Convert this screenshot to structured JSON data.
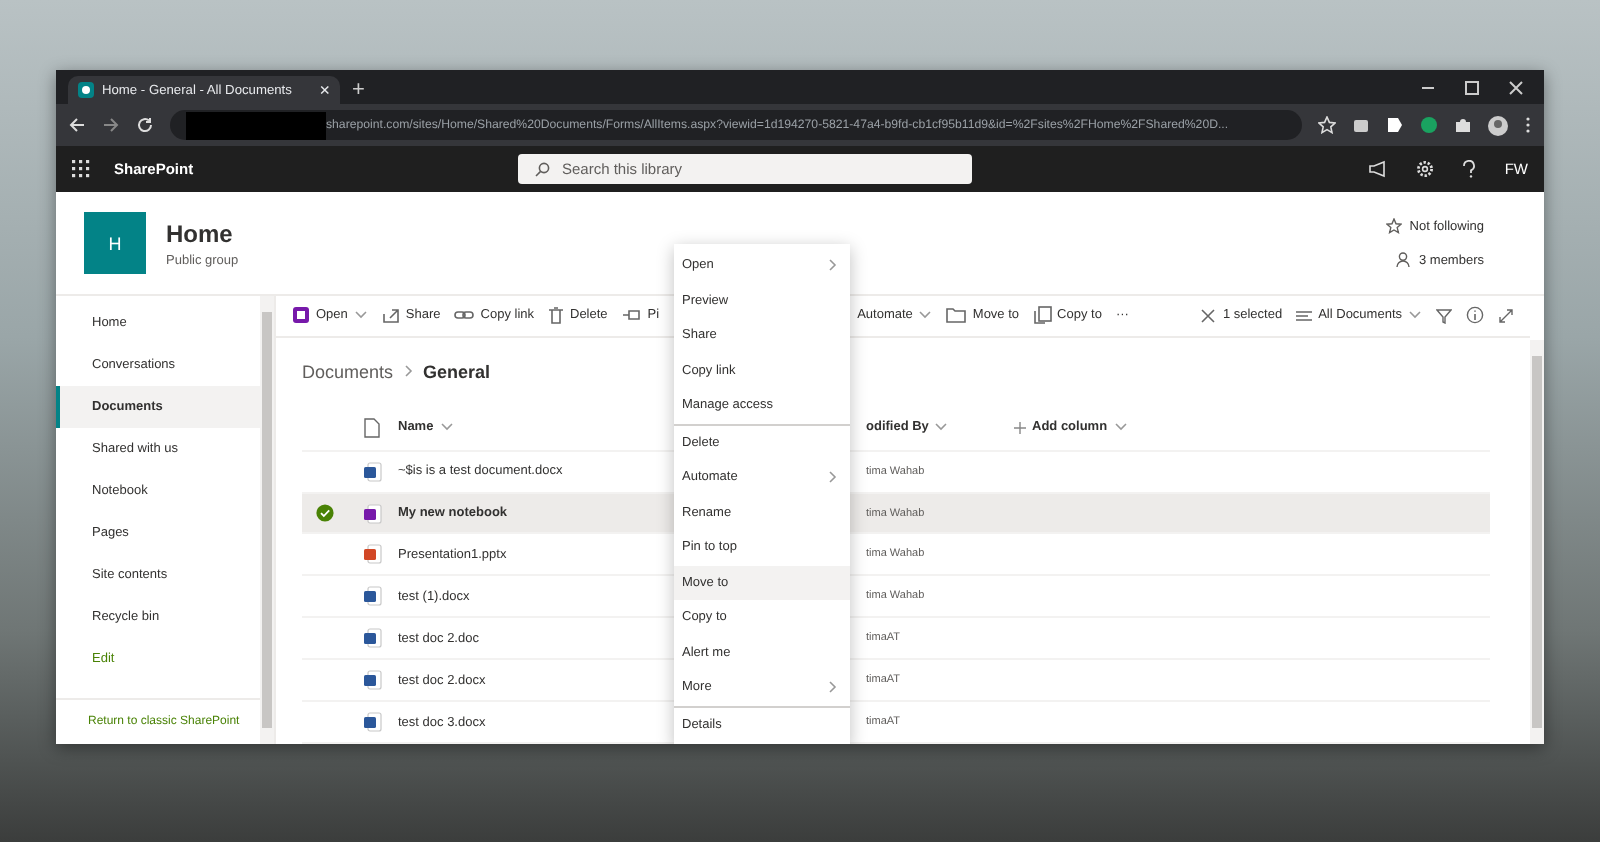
{
  "browser": {
    "tab_title": "Home - General - All Documents",
    "tab_close": "×",
    "new_tab": "+",
    "address": "sharepoint.com/sites/Home/Shared%20Documents/Forms/AllItems.aspx?viewid=1d194270-5821-47a4-b9fd-cb1cf95b11d9&id=%2Fsites%2FHome%2FShared%20D..."
  },
  "suite_bar": {
    "app_name": "SharePoint",
    "search_placeholder": "Search this library",
    "user_initials": "FW"
  },
  "site": {
    "logo_letter": "H",
    "title": "Home",
    "subtitle": "Public group",
    "follow": "Not following",
    "members": "3 members"
  },
  "nav": {
    "items": [
      {
        "label": "Home",
        "selected": false,
        "kind": "page"
      },
      {
        "label": "Conversations",
        "selected": false,
        "kind": "page"
      },
      {
        "label": "Documents",
        "selected": true,
        "kind": "page"
      },
      {
        "label": "Shared with us",
        "selected": false,
        "kind": "page"
      },
      {
        "label": "Notebook",
        "selected": false,
        "kind": "page"
      },
      {
        "label": "Pages",
        "selected": false,
        "kind": "page"
      },
      {
        "label": "Site contents",
        "selected": false,
        "kind": "page"
      },
      {
        "label": "Recycle bin",
        "selected": false,
        "kind": "page"
      },
      {
        "label": "Edit",
        "selected": false,
        "kind": "link"
      }
    ],
    "footer": "Return to classic SharePoint"
  },
  "command_bar": {
    "items": [
      {
        "label": "Open",
        "kind": "notebook",
        "dropdown": true
      },
      {
        "label": "Share",
        "kind": "share",
        "dropdown": false
      },
      {
        "label": "Copy link",
        "kind": "link",
        "dropdown": false
      },
      {
        "label": "Delete",
        "kind": "trash",
        "dropdown": false
      },
      {
        "label": "Pi",
        "kind": "pin",
        "dropdown": false
      },
      {
        "label": "Automate",
        "kind": "plain",
        "dropdown": true
      },
      {
        "label": "Move to",
        "kind": "folder",
        "dropdown": false
      },
      {
        "label": "Copy to",
        "kind": "copy",
        "dropdown": false
      },
      {
        "label": "···",
        "kind": "plain",
        "dropdown": false
      }
    ],
    "selection": "1 selected",
    "view": "All Documents"
  },
  "breadcrumb": [
    "Documents",
    "General"
  ],
  "table": {
    "columns": [
      {
        "label": "Name"
      },
      {
        "label": "odified By"
      },
      {
        "label": "Add column"
      }
    ],
    "rows": [
      {
        "name": "~$is is a test document.docx",
        "kind": "word",
        "modified_by": "tima Wahab",
        "selected": false
      },
      {
        "name": "My new notebook",
        "kind": "onenote",
        "modified_by": "tima Wahab",
        "selected": true
      },
      {
        "name": "Presentation1.pptx",
        "kind": "powerpoint",
        "modified_by": "tima Wahab",
        "selected": false
      },
      {
        "name": "test (1).docx",
        "kind": "word",
        "modified_by": "tima Wahab",
        "selected": false
      },
      {
        "name": "test doc 2.doc",
        "kind": "word",
        "modified_by": "timaAT",
        "selected": false
      },
      {
        "name": "test doc 2.docx",
        "kind": "word",
        "modified_by": "timaAT",
        "selected": false
      },
      {
        "name": "test doc 3.docx",
        "kind": "word",
        "modified_by": "timaAT",
        "selected": false
      }
    ]
  },
  "context_menu": {
    "items": [
      {
        "label": "Open",
        "submenu": true,
        "hovered": false,
        "separator_before": false
      },
      {
        "label": "Preview",
        "submenu": false,
        "hovered": false,
        "separator_before": false
      },
      {
        "label": "Share",
        "submenu": false,
        "hovered": false,
        "separator_before": false
      },
      {
        "label": "Copy link",
        "submenu": false,
        "hovered": false,
        "separator_before": false
      },
      {
        "label": "Manage access",
        "submenu": false,
        "hovered": false,
        "separator_before": false
      },
      {
        "label": "Delete",
        "submenu": false,
        "hovered": false,
        "separator_before": true
      },
      {
        "label": "Automate",
        "submenu": true,
        "hovered": false,
        "separator_before": false
      },
      {
        "label": "Rename",
        "submenu": false,
        "hovered": false,
        "separator_before": false
      },
      {
        "label": "Pin to top",
        "submenu": false,
        "hovered": false,
        "separator_before": false
      },
      {
        "label": "Move to",
        "submenu": false,
        "hovered": true,
        "separator_before": false
      },
      {
        "label": "Copy to",
        "submenu": false,
        "hovered": false,
        "separator_before": false
      },
      {
        "label": "Alert me",
        "submenu": false,
        "hovered": false,
        "separator_before": false
      },
      {
        "label": "More",
        "submenu": true,
        "hovered": false,
        "separator_before": false
      },
      {
        "label": "Details",
        "submenu": false,
        "hovered": false,
        "separator_before": true
      }
    ]
  }
}
